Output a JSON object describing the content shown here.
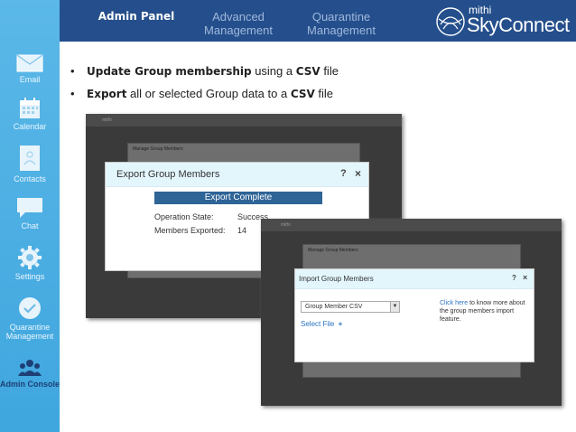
{
  "sidebar": {
    "items": [
      {
        "label": "Email",
        "icon": "envelope-icon"
      },
      {
        "label": "Calendar",
        "icon": "calendar-icon"
      },
      {
        "label": "Contacts",
        "icon": "contacts-icon"
      },
      {
        "label": "Chat",
        "icon": "chat-bubble-icon"
      },
      {
        "label": "Settings",
        "icon": "gear-icon"
      },
      {
        "label": "Quarantine Management",
        "icon": "shield-check-icon"
      },
      {
        "label": "Admin Console",
        "icon": "users-icon",
        "active": true
      }
    ]
  },
  "header": {
    "tabs": [
      {
        "label": "Admin Panel",
        "active": true
      },
      {
        "label": "Advanced Management"
      },
      {
        "label": "Quarantine Management"
      }
    ],
    "brand_small": "mithi",
    "brand_big": "SkyConnect"
  },
  "bullets": {
    "b1_bold": "Update Group membership",
    "b1_rest": " using a ",
    "b1_bold2": "CSV",
    "b1_end": " file",
    "b2_bold": "Export",
    "b2_rest": "  all or selected Group data to a ",
    "b2_bold2": "CSV",
    "b2_end": " file",
    "marker": "•"
  },
  "export_dialog": {
    "title": "Export Group Members",
    "help": "?",
    "close": "×",
    "status": "Export Complete",
    "state_label": "Operation State:",
    "state_value": "Success",
    "members_label": "Members Exported:",
    "members_value": "14"
  },
  "import_dialog": {
    "title": "Import Group Members",
    "help": "?",
    "close": "×",
    "select_value": "Group Member CSV",
    "select_file": "Select File",
    "select_file_plus": "+",
    "help_link": "Click here",
    "help_text": " to know more about the group members import feature."
  },
  "background": {
    "manage_title": "Manage Group Members",
    "app_name": "mithi"
  },
  "colors": {
    "sidebar": "#4aaee2",
    "topbar": "#254f8c",
    "status": "#2f6497",
    "dialog_header": "#e3f6fc"
  }
}
